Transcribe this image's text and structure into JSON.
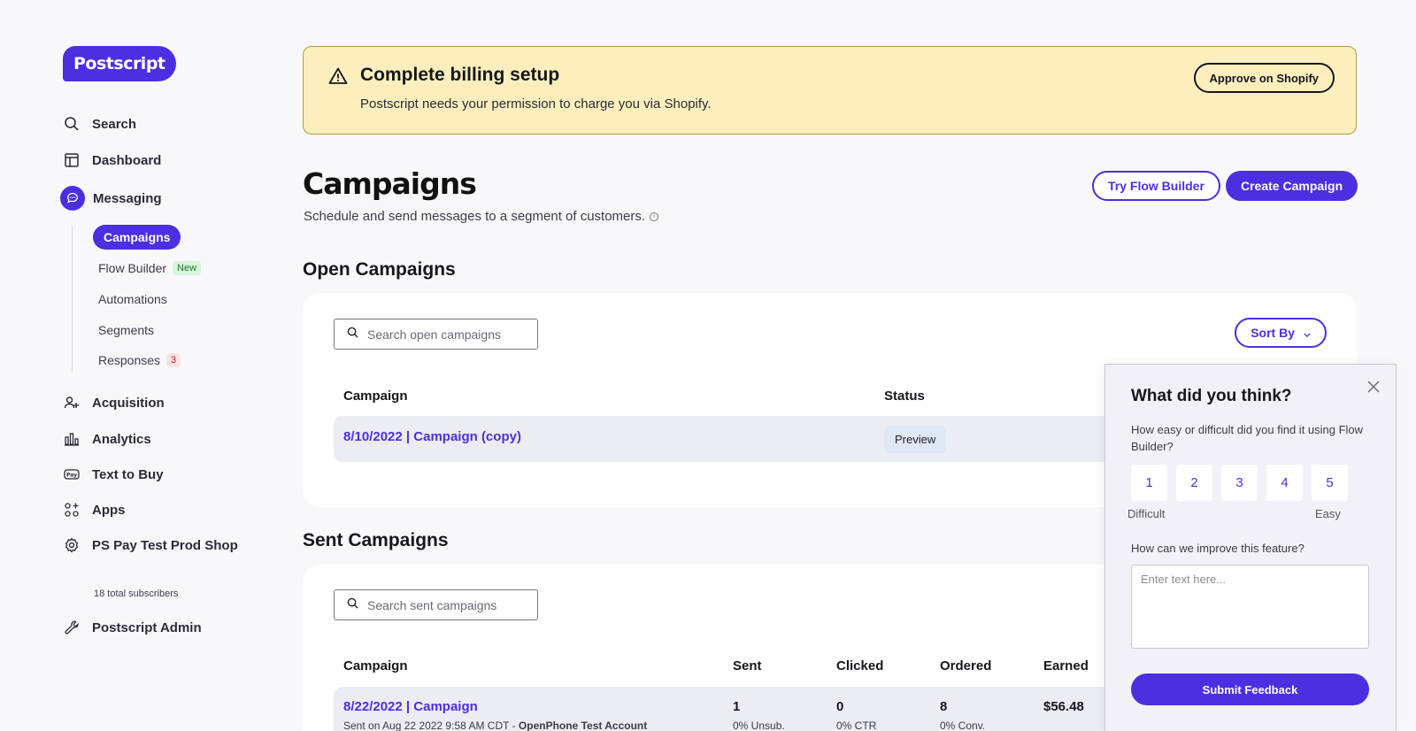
{
  "brand": {
    "logo_text": "Postscript",
    "accent": "#4b2fe0"
  },
  "sidebar": {
    "items": [
      {
        "label": "Search",
        "icon": "search-icon"
      },
      {
        "label": "Dashboard",
        "icon": "dashboard-icon"
      },
      {
        "label": "Messaging",
        "icon": "chat-bubble-icon"
      },
      {
        "label": "Acquisition",
        "icon": "people-add-icon"
      },
      {
        "label": "Analytics",
        "icon": "bar-chart-icon"
      },
      {
        "label": "Text to Buy",
        "icon": "pay-icon"
      },
      {
        "label": "Apps",
        "icon": "apps-grid-icon"
      },
      {
        "label": "PS Pay Test Prod Shop",
        "icon": "gear-icon"
      }
    ],
    "messaging_sub": [
      {
        "label": "Campaigns"
      },
      {
        "label": "Flow Builder",
        "badge": "New"
      },
      {
        "label": "Automations"
      },
      {
        "label": "Segments"
      },
      {
        "label": "Responses",
        "badge": "3"
      }
    ],
    "subscribers": "18 total subscribers",
    "admin": {
      "label": "Postscript Admin",
      "icon": "wrench-icon"
    }
  },
  "banner": {
    "title": "Complete billing setup",
    "text": "Postscript needs your permission to charge you via Shopify.",
    "button": "Approve on Shopify",
    "icon": "warning-icon"
  },
  "header": {
    "title": "Campaigns",
    "subtitle": "Schedule and send messages to a segment of customers.",
    "info_icon": "info-icon",
    "try_button": "Try Flow Builder",
    "create_button": "Create Campaign"
  },
  "open_campaigns": {
    "title": "Open Campaigns",
    "search_placeholder": "Search open campaigns",
    "sort_label": "Sort By",
    "columns": [
      "Campaign",
      "Status"
    ],
    "rows": [
      {
        "name": "8/10/2022 | Campaign (copy)",
        "status": "Preview"
      }
    ]
  },
  "sent_campaigns": {
    "title": "Sent Campaigns",
    "search_placeholder": "Search sent campaigns",
    "columns": [
      "Campaign",
      "Sent",
      "Clicked",
      "Ordered",
      "Earned"
    ],
    "rows": [
      {
        "name": "8/22/2022 | Campaign",
        "meta_prefix": "Sent on Aug 22 2022 9:58 AM CDT - ",
        "meta_account": "OpenPhone Test Account",
        "sent": "1",
        "sent_sub": "0% Unsub.",
        "clicked": "0",
        "clicked_sub": "0% CTR",
        "ordered": "8",
        "ordered_sub": "0% Conv.",
        "earned": "$56.48"
      }
    ]
  },
  "feedback": {
    "title": "What did you think?",
    "question1": "How easy or difficult did you find it using Flow Builder?",
    "ratings": [
      "1",
      "2",
      "3",
      "4",
      "5"
    ],
    "low_label": "Difficult",
    "high_label": "Easy",
    "question2": "How can we improve this feature?",
    "placeholder": "Enter text here...",
    "submit": "Submit Feedback"
  }
}
